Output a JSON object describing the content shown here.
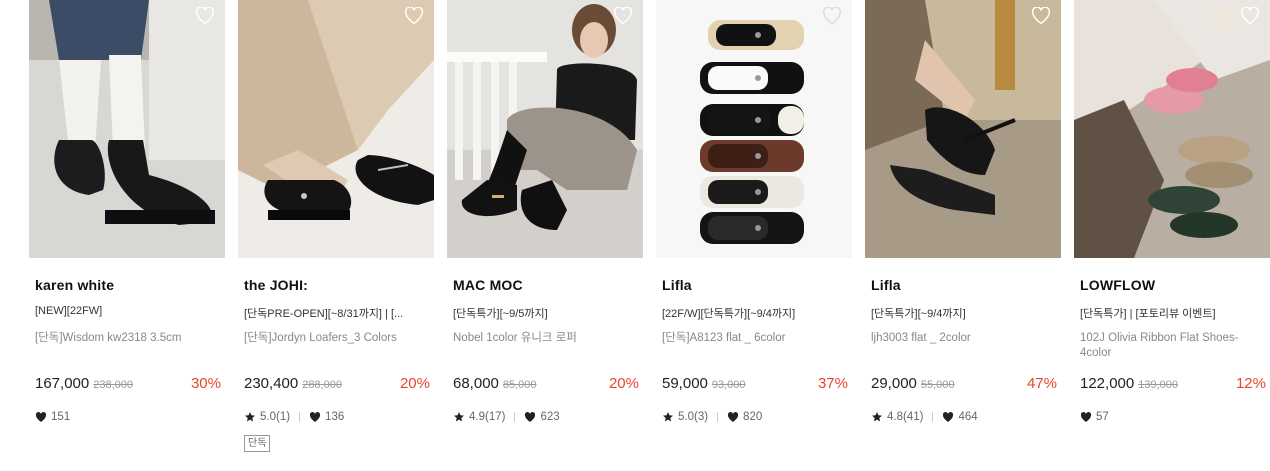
{
  "products": [
    {
      "brand": "karen white",
      "tag": "[NEW][22FW]",
      "name": "[단독]Wisdom kw2318 3.5cm",
      "price": "167,000",
      "original_price": "238,000",
      "discount": "30%",
      "rating": "",
      "likes": "151",
      "badge": "",
      "image_desc": "black loafers with white socks, jeans"
    },
    {
      "brand": "the JOHI:",
      "tag": "[단독PRE-OPEN][~8/31까지] | [...",
      "name": "[단독]Jordyn Loafers_3 Colors",
      "price": "230,400",
      "original_price": "288,000",
      "discount": "20%",
      "rating": "5.0(1)",
      "likes": "136",
      "badge": "단독",
      "image_desc": "black chain loafers, beige trousers"
    },
    {
      "brand": "MAC MOC",
      "tag": "[단독특가][~9/5까지]",
      "name": "Nobel 1color 유니크 로퍼",
      "price": "68,000",
      "original_price": "85,000",
      "discount": "20%",
      "rating": "4.9(17)",
      "likes": "623",
      "badge": "",
      "image_desc": "model sitting on floor in black loafers"
    },
    {
      "brand": "Lifla",
      "tag": "[22F/W][단독특가][~9/4까지]",
      "name": "[단독]A8123 flat _ 6color",
      "price": "59,000",
      "original_price": "93,000",
      "discount": "37%",
      "rating": "5.0(3)",
      "likes": "820",
      "badge": "",
      "image_desc": "six pairs of mary jane flats stacked"
    },
    {
      "brand": "Lifla",
      "tag": "[단독특가][~9/4까지]",
      "name": "ljh3003 flat _ 2color",
      "price": "29,000",
      "original_price": "55,000",
      "discount": "47%",
      "rating": "4.8(41)",
      "likes": "464",
      "badge": "",
      "image_desc": "black ruched mary jane flat on foot"
    },
    {
      "brand": "LOWFLOW",
      "tag": "[단독특가] | [포토리뷰 이벤트]",
      "name": "102J Olivia Ribbon Flat Shoes-4color",
      "price": "122,000",
      "original_price": "139,000",
      "discount": "12%",
      "rating": "",
      "likes": "57",
      "badge": "",
      "image_desc": "ribbon ballet flats in pink, khaki, green"
    }
  ],
  "colors": {
    "discount": "#e8452c",
    "text": "#222222",
    "muted": "#888888"
  },
  "icons": {
    "wishlist": "heart-outline-icon",
    "rating": "star-icon",
    "likes": "heart-filled-icon"
  }
}
